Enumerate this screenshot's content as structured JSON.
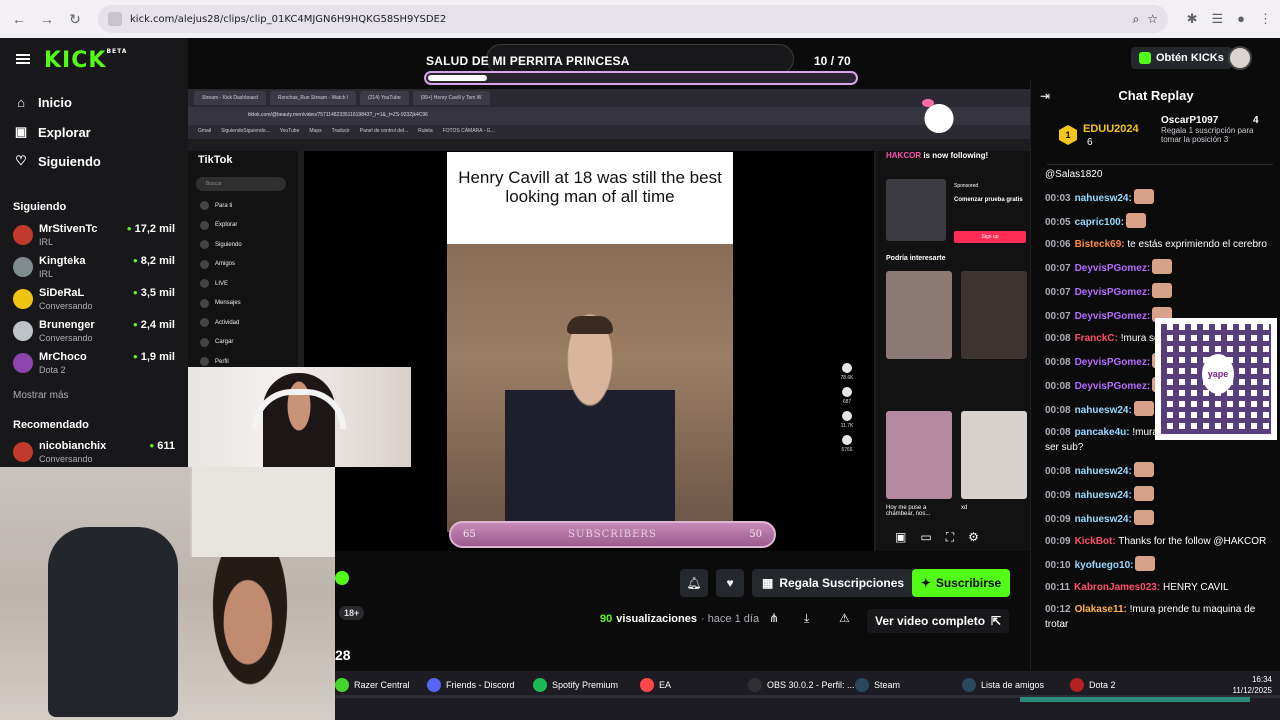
{
  "browser": {
    "url": "kick.com/alejus28/clips/clip_01KC4MJGN6H9HQKG58SH9YSDE2",
    "nav_back": "←",
    "nav_forward": "→",
    "reload": "↻"
  },
  "kick": {
    "logo": "KICK",
    "logo_beta": "BETA",
    "nav": [
      {
        "label": "Inicio",
        "icon": "home-icon"
      },
      {
        "label": "Explorar",
        "icon": "compass-icon"
      },
      {
        "label": "Siguiendo",
        "icon": "heart-icon"
      }
    ],
    "following_title": "Siguiendo",
    "following": [
      {
        "name": "MrStivenTc",
        "sub": "IRL",
        "count": "17,2 mil",
        "color": "#c0392b"
      },
      {
        "name": "Kingteka",
        "sub": "IRL",
        "count": "8,2 mil",
        "color": "#7f8c8d"
      },
      {
        "name": "SiDeRaL",
        "sub": "Conversando",
        "count": "3,5 mil",
        "color": "#f1c40f"
      },
      {
        "name": "Brunenger",
        "sub": "Conversando",
        "count": "2,4 mil",
        "color": "#bdc3c7"
      },
      {
        "name": "MrChoco",
        "sub": "Dota 2",
        "count": "1,9 mil",
        "color": "#8e44ad"
      }
    ],
    "show_more": "Mostrar más",
    "recommended_title": "Recomendado",
    "recommended": [
      {
        "name": "nicobianchix",
        "sub": "Conversando",
        "count": "611",
        "color": "#c0392b"
      }
    ],
    "obtain_kicks": "Obtén KICKs"
  },
  "stream_overlay": {
    "goal_title": "SALUD DE MI PERRITA PRINCESA",
    "goal_current": "10",
    "goal_sep": " / ",
    "goal_total": "70",
    "goal_progress": 0.14,
    "subs_left": "65",
    "subs_label": "SUBSCRIBERS",
    "subs_right": "50"
  },
  "inner_browser": {
    "tabs": [
      "Stream - Kick Dashboard",
      "Ronchas_Run Stream - Watch l",
      "(214) YouTube",
      "(99+) Henry Cavill y Tom W"
    ],
    "url": "tiktok.com/@beauty.men/video/7571148233511619843?_r=1&_t=ZS-923Zjk4C96",
    "bookmarks": [
      "Gmail",
      "SiguiendoSiguiendo...",
      "YouTube",
      "Maps",
      "Traducir",
      "Panel de control del...",
      "Ruleta",
      "FOTOS CÁMARA - G..."
    ]
  },
  "tiktok": {
    "logo": "TikTok",
    "search_placeholder": "Buscar",
    "menu": [
      "Para ti",
      "Explorar",
      "Siguiendo",
      "Amigos",
      "LIVE",
      "Mensajes",
      "Actividad",
      "Cargar",
      "Perfil"
    ],
    "caption": "Henry Cavill at 18 was still the best looking man of all time",
    "counts": [
      "78.6K",
      "687",
      "11.7K",
      "6766"
    ],
    "follow_user": "HAKCOR",
    "follow_text": " is now following!",
    "sponsored": "Sponsored",
    "trial": "Comenzar prueba gratis",
    "signup": "Sign up",
    "suggest_title": "Podría interesarte",
    "suggest_caption": "Hoy me puse a chambear, nos...",
    "suggest_user": "xd"
  },
  "clip_info": {
    "age": "18+",
    "clip_suffix": "28",
    "gift_subs": "Regala Suscripciones",
    "subscribe": "Suscribirse",
    "views_count": "90",
    "views_label": "visualizaciones",
    "posted": "· hace 1 día",
    "full_video": "Ver video completo"
  },
  "chat": {
    "title": "Chat Replay",
    "leader": {
      "name": "EDUU2024",
      "count": "6",
      "rank": "1"
    },
    "gifter": {
      "name": "OscarP1097",
      "count": "4",
      "note": "Regala 1 suscripción para tomar la posición 3"
    },
    "messages": [
      {
        "time": "",
        "user": "",
        "color": "#fff",
        "text": "@Salas1820",
        "emote": false
      },
      {
        "time": "00:03",
        "user": "nahuesw24:",
        "color": "#9ad8ff",
        "text": "",
        "emote": true
      },
      {
        "time": "00:05",
        "user": "capric100:",
        "color": "#9ad8ff",
        "text": "",
        "emote": true
      },
      {
        "time": "00:06",
        "user": "Bisteck69:",
        "color": "#ff8a3d",
        "text": " te estás exprimiendo el cerebro",
        "emote": false
      },
      {
        "time": "00:07",
        "user": "DeyvisPGomez:",
        "color": "#b36bff",
        "text": "",
        "emote": true
      },
      {
        "time": "00:07",
        "user": "DeyvisPGomez:",
        "color": "#b36bff",
        "text": "",
        "emote": true
      },
      {
        "time": "00:07",
        "user": "DeyvisPGomez:",
        "color": "#b36bff",
        "text": "",
        "emote": true
      },
      {
        "time": "00:08",
        "user": "FranckC:",
        "color": "#ff4f6a",
        "text": " !mura se cerebro por la nariz aleji",
        "emote": false
      },
      {
        "time": "00:08",
        "user": "DeyvisPGomez:",
        "color": "#b36bff",
        "text": "",
        "emote": true
      },
      {
        "time": "00:08",
        "user": "DeyvisPGomez:",
        "color": "#b36bff",
        "text": "",
        "emote": true
      },
      {
        "time": "00:08",
        "user": "nahuesw24:",
        "color": "#9ad8ff",
        "text": "",
        "emote": true
      },
      {
        "time": "00:08",
        "user": "pancake4u:",
        "color": "#9ad8ff",
        "text": " !mura alejus beneficios para ser sub?",
        "emote": false
      },
      {
        "time": "00:08",
        "user": "nahuesw24:",
        "color": "#9ad8ff",
        "text": "",
        "emote": true
      },
      {
        "time": "00:09",
        "user": "nahuesw24:",
        "color": "#9ad8ff",
        "text": "",
        "emote": true
      },
      {
        "time": "00:09",
        "user": "nahuesw24:",
        "color": "#9ad8ff",
        "text": "",
        "emote": true
      },
      {
        "time": "00:09",
        "user": "KickBot:",
        "color": "#ff4f6a",
        "text": " Thanks for the follow @HAKCOR",
        "emote": false
      },
      {
        "time": "00:10",
        "user": "kyofuego10:",
        "color": "#9ad8ff",
        "text": "",
        "emote": true
      },
      {
        "time": "00:11",
        "user": "KabronJames023:",
        "color": "#ff4f6a",
        "text": " HENRY CAVIL",
        "emote": false
      },
      {
        "time": "00:12",
        "user": "Olakase11:",
        "color": "#ffb347",
        "text": " !mura prende tu maquina de trotar",
        "emote": false
      }
    ],
    "qr_brand": "yape"
  },
  "taskbar": {
    "items": [
      {
        "label": "Razer Central",
        "color": "#44d62c"
      },
      {
        "label": "Friends - Discord",
        "color": "#5865f2"
      },
      {
        "label": "Spotify Premium",
        "color": "#1db954"
      },
      {
        "label": "EA",
        "color": "#ff4747"
      },
      {
        "label": "OBS 30.0.2 - Perfil: ...",
        "color": "#302e31"
      },
      {
        "label": "Steam",
        "color": "#2a475e"
      },
      {
        "label": "Lista de amigos",
        "color": "#2a475e"
      },
      {
        "label": "Dota 2",
        "color": "#b22222"
      }
    ],
    "time": "16:34",
    "date": "11/12/2025"
  }
}
